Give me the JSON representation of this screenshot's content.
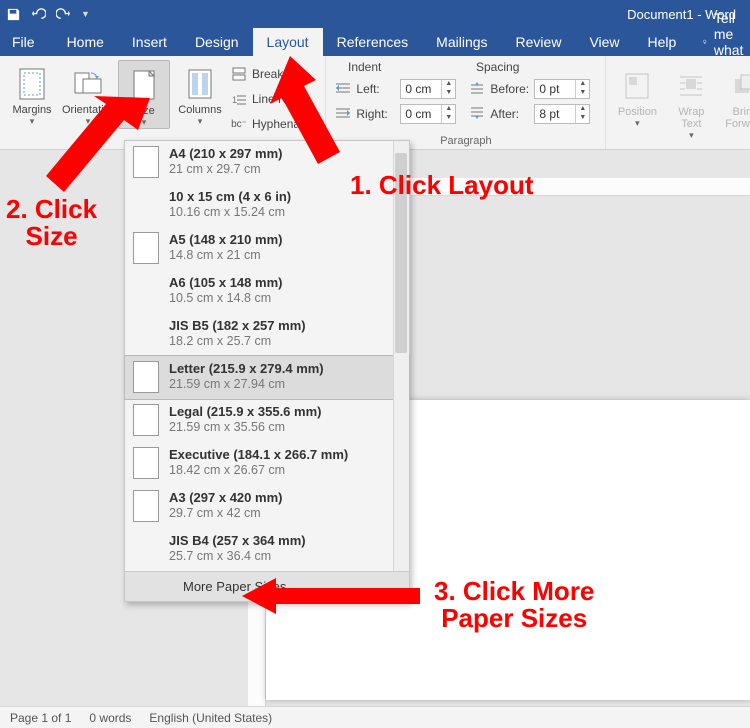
{
  "title": "Document1 - Word",
  "tabs": {
    "file": "File",
    "home": "Home",
    "insert": "Insert",
    "design": "Design",
    "layout": "Layout",
    "references": "References",
    "mailings": "Mailings",
    "review": "Review",
    "view": "View",
    "help": "Help",
    "tellme": "Tell me what yo"
  },
  "pageSetup": {
    "margins": "Margins",
    "orientation": "Orientation",
    "size": "Size",
    "columns": "Columns",
    "breaks": "Breaks",
    "lineNumbers": "Line Num",
    "hyphenation": "Hyphenation"
  },
  "indent": {
    "header": "Indent",
    "leftLabel": "Left:",
    "leftValue": "0 cm",
    "rightLabel": "Right:",
    "rightValue": "0 cm"
  },
  "spacing": {
    "header": "Spacing",
    "beforeLabel": "Before:",
    "beforeValue": "0 pt",
    "afterLabel": "After:",
    "afterValue": "8 pt"
  },
  "paragraphGroup": "Paragraph",
  "arrange": {
    "position": "Position",
    "wrap": "Wrap\nText",
    "forward": "Bring\nForward"
  },
  "sizeMenu": {
    "items": [
      {
        "title": "A4 (210 x 297 mm)",
        "dims": "21 cm x 29.7 cm",
        "iconBlank": false
      },
      {
        "title": "10 x 15 cm (4 x 6 in)",
        "dims": "10.16 cm x 15.24 cm",
        "iconBlank": true
      },
      {
        "title": "A5 (148 x 210 mm)",
        "dims": "14.8 cm x 21 cm",
        "iconBlank": false
      },
      {
        "title": "A6 (105 x 148 mm)",
        "dims": "10.5 cm x 14.8 cm",
        "iconBlank": true
      },
      {
        "title": "JIS B5 (182 x 257 mm)",
        "dims": "18.2 cm x 25.7 cm",
        "iconBlank": true
      },
      {
        "title": "Letter (215.9 x 279.4 mm)",
        "dims": "21.59 cm x 27.94 cm",
        "iconBlank": false,
        "selected": true
      },
      {
        "title": "Legal (215.9 x 355.6 mm)",
        "dims": "21.59 cm x 35.56 cm",
        "iconBlank": false
      },
      {
        "title": "Executive (184.1 x 266.7 mm)",
        "dims": "18.42 cm x 26.67 cm",
        "iconBlank": false
      },
      {
        "title": "A3 (297 x 420 mm)",
        "dims": "29.7 cm x 42 cm",
        "iconBlank": false
      },
      {
        "title": "JIS B4 (257 x 364 mm)",
        "dims": "25.7 cm x 36.4 cm",
        "iconBlank": true
      }
    ],
    "more": "More Paper Sizes..."
  },
  "status": {
    "page": "Page 1 of 1",
    "words": "0 words",
    "lang": "English (United States)"
  },
  "annotations": {
    "a1": "1. Click Layout",
    "a2": "2. Click\nSize",
    "a3": "3. Click More\nPaper Sizes"
  }
}
